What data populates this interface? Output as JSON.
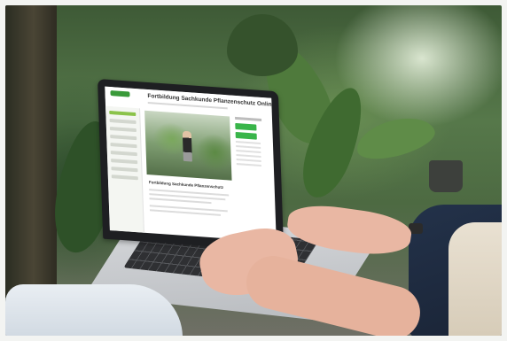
{
  "photo": {
    "subject": "laptop-on-lap-outdoors-with-plants"
  },
  "screen": {
    "page_title": "Fortbildung Sachkunde Pflanzenschutz Online",
    "section_heading": "Fortbildung Sachkunde Pflanzenschutz"
  },
  "colors": {
    "brand_green": "#39b54a",
    "accent_green": "#8bc34a"
  }
}
